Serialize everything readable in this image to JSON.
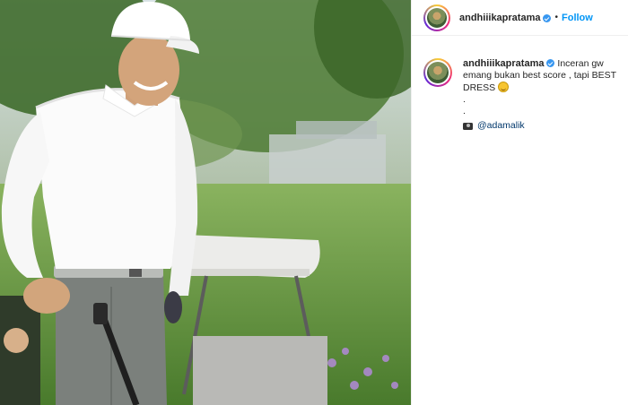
{
  "post": {
    "username": "andhiiikapratama",
    "separator": "•",
    "follow_label": "Follow",
    "caption": {
      "username": "andhiiikapratama",
      "text": "Inceran gw emang bukan best score , tapi BEST DRESS",
      "emoji": "laughing-face-emoji",
      "dot_lines": [
        ".",
        "."
      ],
      "credit_icon": "camera-icon",
      "mention": "@adamalik"
    }
  },
  "colors": {
    "follow": "#0095f6",
    "verified": "#3897f0",
    "mention": "#00376b",
    "text": "#262626"
  }
}
